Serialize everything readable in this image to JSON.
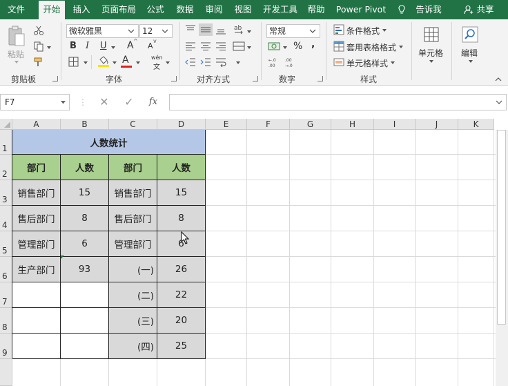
{
  "tabs": [
    "文件",
    "开始",
    "插入",
    "页面布局",
    "公式",
    "数据",
    "审阅",
    "视图",
    "开发工具",
    "帮助",
    "Power Pivot",
    "告诉我",
    "共享"
  ],
  "ribbon": {
    "clipboard": {
      "paste": "粘贴",
      "label": "剪贴板"
    },
    "font": {
      "name": "微软雅黑",
      "size": "12",
      "bold": "B",
      "italic": "I",
      "underline": "U",
      "grow": "A",
      "shrink": "A",
      "font_color_letter": "A",
      "phonetic_top": "wén",
      "phonetic_bottom": "文",
      "label": "字体"
    },
    "alignment": {
      "label": "对齐方式"
    },
    "number": {
      "format": "常规",
      "percent": "%",
      "comma": ",",
      "label": "数字"
    },
    "styles": {
      "conditional": "条件格式",
      "table": "套用表格格式",
      "cell_styles": "单元格样式",
      "label": "样式"
    },
    "cells": {
      "label": "单元格"
    },
    "editing": {
      "label": "编辑"
    }
  },
  "formula_bar": {
    "name_box": "F7",
    "fx": "fx",
    "formula": ""
  },
  "grid": {
    "columns": [
      "A",
      "B",
      "C",
      "D",
      "E",
      "F",
      "G",
      "H",
      "I",
      "J",
      "K"
    ],
    "rows": [
      "1",
      "2",
      "3",
      "4",
      "5",
      "6",
      "7",
      "8",
      "9"
    ],
    "title": "人数统计",
    "headers": [
      "部门",
      "人数",
      "部门",
      "人数"
    ],
    "table_rows": [
      [
        "销售部门",
        "15",
        "销售部门",
        "15"
      ],
      [
        "售后部门",
        "8",
        "售后部门",
        "8"
      ],
      [
        "管理部门",
        "6",
        "管理部门",
        "6"
      ],
      [
        "生产部门",
        "93",
        "(一)",
        "26"
      ],
      [
        "",
        "",
        "(二)",
        "22"
      ],
      [
        "",
        "",
        "(三)",
        "20"
      ],
      [
        "",
        "",
        "(四)",
        "25"
      ]
    ]
  },
  "colors": {
    "accent": "#217346",
    "title_fill": "#b4c7e7",
    "header_fill": "#a9d08e",
    "data_fill": "#d9d9d9"
  }
}
